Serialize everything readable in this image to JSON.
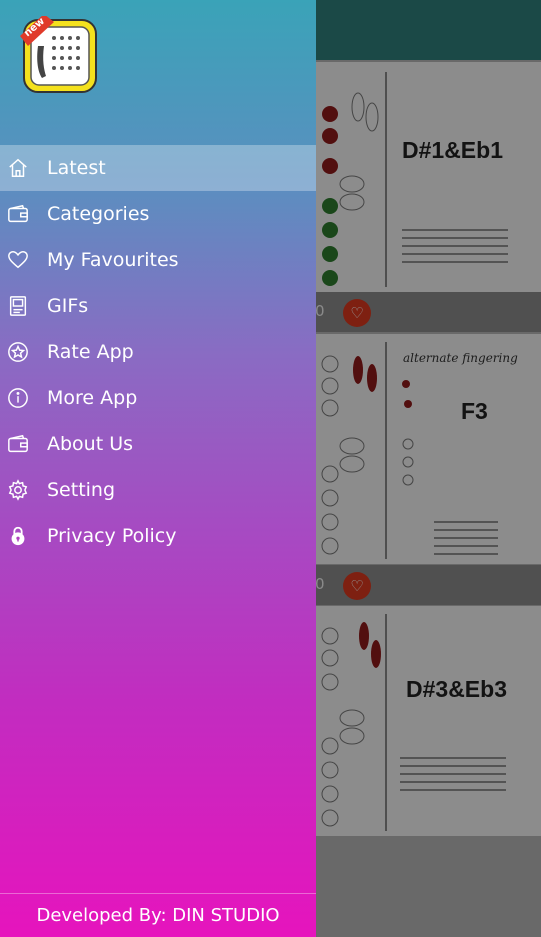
{
  "drawer": {
    "logo_badge": "new",
    "items": [
      {
        "label": "Latest",
        "icon": "home-icon",
        "active": true
      },
      {
        "label": "Categories",
        "icon": "wallet-icon",
        "active": false
      },
      {
        "label": "My Favourites",
        "icon": "heart-icon",
        "active": false
      },
      {
        "label": "GIFs",
        "icon": "gif-file-icon",
        "active": false
      },
      {
        "label": "Rate App",
        "icon": "star-circle-icon",
        "active": false
      },
      {
        "label": "More App",
        "icon": "info-circle-icon",
        "active": false
      },
      {
        "label": "About Us",
        "icon": "wallet-icon",
        "active": false
      },
      {
        "label": "Setting",
        "icon": "gear-icon",
        "active": false
      },
      {
        "label": "Privacy Policy",
        "icon": "lock-icon",
        "active": false
      }
    ],
    "footer": "Developed By: DIN STUDIO"
  },
  "content": {
    "cards": [
      {
        "title": "D#1&Eb1",
        "note": ""
      },
      {
        "title": "F3",
        "note": "alternate fingering"
      },
      {
        "title": "D#3&Eb3",
        "note": ""
      }
    ],
    "favourite_count": "0"
  },
  "colors": {
    "gradient_top": "#3aa3b8",
    "gradient_bottom": "#e614bd",
    "heart_button": "#d9381e",
    "topbar": "#2f7f7a"
  }
}
